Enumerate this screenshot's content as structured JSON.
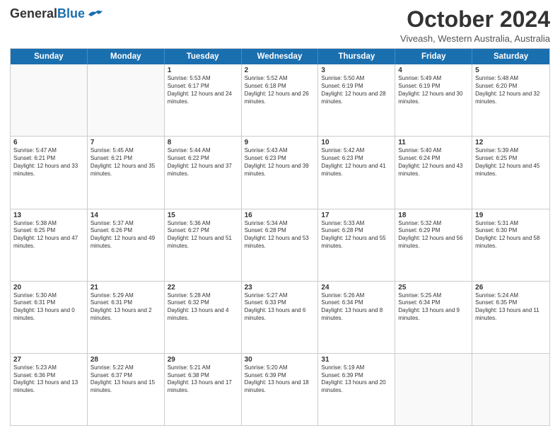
{
  "header": {
    "logo_general": "General",
    "logo_blue": "Blue",
    "month_title": "October 2024",
    "subtitle": "Viveash, Western Australia, Australia"
  },
  "calendar": {
    "days_of_week": [
      "Sunday",
      "Monday",
      "Tuesday",
      "Wednesday",
      "Thursday",
      "Friday",
      "Saturday"
    ],
    "rows": [
      [
        {
          "day": "",
          "content": ""
        },
        {
          "day": "",
          "content": ""
        },
        {
          "day": "1",
          "content": "Sunrise: 5:53 AM\nSunset: 6:17 PM\nDaylight: 12 hours and 24 minutes."
        },
        {
          "day": "2",
          "content": "Sunrise: 5:52 AM\nSunset: 6:18 PM\nDaylight: 12 hours and 26 minutes."
        },
        {
          "day": "3",
          "content": "Sunrise: 5:50 AM\nSunset: 6:19 PM\nDaylight: 12 hours and 28 minutes."
        },
        {
          "day": "4",
          "content": "Sunrise: 5:49 AM\nSunset: 6:19 PM\nDaylight: 12 hours and 30 minutes."
        },
        {
          "day": "5",
          "content": "Sunrise: 5:48 AM\nSunset: 6:20 PM\nDaylight: 12 hours and 32 minutes."
        }
      ],
      [
        {
          "day": "6",
          "content": "Sunrise: 5:47 AM\nSunset: 6:21 PM\nDaylight: 12 hours and 33 minutes."
        },
        {
          "day": "7",
          "content": "Sunrise: 5:45 AM\nSunset: 6:21 PM\nDaylight: 12 hours and 35 minutes."
        },
        {
          "day": "8",
          "content": "Sunrise: 5:44 AM\nSunset: 6:22 PM\nDaylight: 12 hours and 37 minutes."
        },
        {
          "day": "9",
          "content": "Sunrise: 5:43 AM\nSunset: 6:23 PM\nDaylight: 12 hours and 39 minutes."
        },
        {
          "day": "10",
          "content": "Sunrise: 5:42 AM\nSunset: 6:23 PM\nDaylight: 12 hours and 41 minutes."
        },
        {
          "day": "11",
          "content": "Sunrise: 5:40 AM\nSunset: 6:24 PM\nDaylight: 12 hours and 43 minutes."
        },
        {
          "day": "12",
          "content": "Sunrise: 5:39 AM\nSunset: 6:25 PM\nDaylight: 12 hours and 45 minutes."
        }
      ],
      [
        {
          "day": "13",
          "content": "Sunrise: 5:38 AM\nSunset: 6:25 PM\nDaylight: 12 hours and 47 minutes."
        },
        {
          "day": "14",
          "content": "Sunrise: 5:37 AM\nSunset: 6:26 PM\nDaylight: 12 hours and 49 minutes."
        },
        {
          "day": "15",
          "content": "Sunrise: 5:36 AM\nSunset: 6:27 PM\nDaylight: 12 hours and 51 minutes."
        },
        {
          "day": "16",
          "content": "Sunrise: 5:34 AM\nSunset: 6:28 PM\nDaylight: 12 hours and 53 minutes."
        },
        {
          "day": "17",
          "content": "Sunrise: 5:33 AM\nSunset: 6:28 PM\nDaylight: 12 hours and 55 minutes."
        },
        {
          "day": "18",
          "content": "Sunrise: 5:32 AM\nSunset: 6:29 PM\nDaylight: 12 hours and 56 minutes."
        },
        {
          "day": "19",
          "content": "Sunrise: 5:31 AM\nSunset: 6:30 PM\nDaylight: 12 hours and 58 minutes."
        }
      ],
      [
        {
          "day": "20",
          "content": "Sunrise: 5:30 AM\nSunset: 6:31 PM\nDaylight: 13 hours and 0 minutes."
        },
        {
          "day": "21",
          "content": "Sunrise: 5:29 AM\nSunset: 6:31 PM\nDaylight: 13 hours and 2 minutes."
        },
        {
          "day": "22",
          "content": "Sunrise: 5:28 AM\nSunset: 6:32 PM\nDaylight: 13 hours and 4 minutes."
        },
        {
          "day": "23",
          "content": "Sunrise: 5:27 AM\nSunset: 6:33 PM\nDaylight: 13 hours and 6 minutes."
        },
        {
          "day": "24",
          "content": "Sunrise: 5:26 AM\nSunset: 6:34 PM\nDaylight: 13 hours and 8 minutes."
        },
        {
          "day": "25",
          "content": "Sunrise: 5:25 AM\nSunset: 6:34 PM\nDaylight: 13 hours and 9 minutes."
        },
        {
          "day": "26",
          "content": "Sunrise: 5:24 AM\nSunset: 6:35 PM\nDaylight: 13 hours and 11 minutes."
        }
      ],
      [
        {
          "day": "27",
          "content": "Sunrise: 5:23 AM\nSunset: 6:36 PM\nDaylight: 13 hours and 13 minutes."
        },
        {
          "day": "28",
          "content": "Sunrise: 5:22 AM\nSunset: 6:37 PM\nDaylight: 13 hours and 15 minutes."
        },
        {
          "day": "29",
          "content": "Sunrise: 5:21 AM\nSunset: 6:38 PM\nDaylight: 13 hours and 17 minutes."
        },
        {
          "day": "30",
          "content": "Sunrise: 5:20 AM\nSunset: 6:39 PM\nDaylight: 13 hours and 18 minutes."
        },
        {
          "day": "31",
          "content": "Sunrise: 5:19 AM\nSunset: 6:39 PM\nDaylight: 13 hours and 20 minutes."
        },
        {
          "day": "",
          "content": ""
        },
        {
          "day": "",
          "content": ""
        }
      ]
    ]
  }
}
